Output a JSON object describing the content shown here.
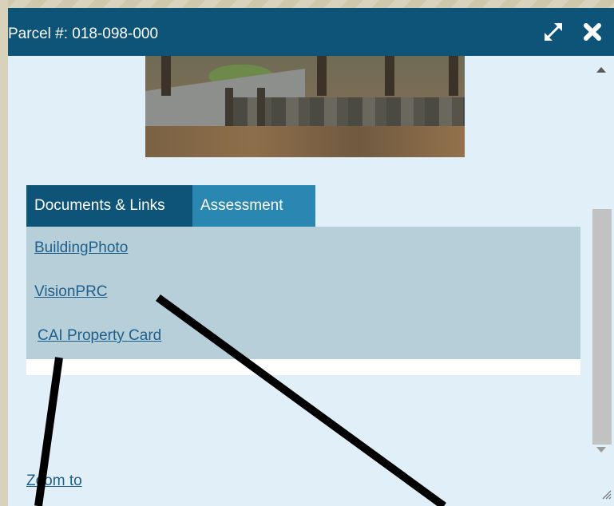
{
  "popup": {
    "title": "Parcel #: 018-098-000",
    "icons": {
      "maximize": "expand-arrows-icon",
      "close": "close-x-icon"
    }
  },
  "tabs": [
    {
      "label": "Documents & Links",
      "active": true
    },
    {
      "label": "Assessment",
      "active": false
    }
  ],
  "links": [
    {
      "label": "BuildingPhoto"
    },
    {
      "label": "VisionPRC"
    },
    {
      "label": "CAI Property Card"
    }
  ],
  "footer": {
    "zoom_label": "Zoom to"
  },
  "colors": {
    "titlebar": "#0e5478",
    "popup_bg": "#e1eff8",
    "tab_active": "#0e5478",
    "tab_inactive": "#2a87b2",
    "panel_bg": "#b6cfd9",
    "link": "#1f5f8c"
  }
}
